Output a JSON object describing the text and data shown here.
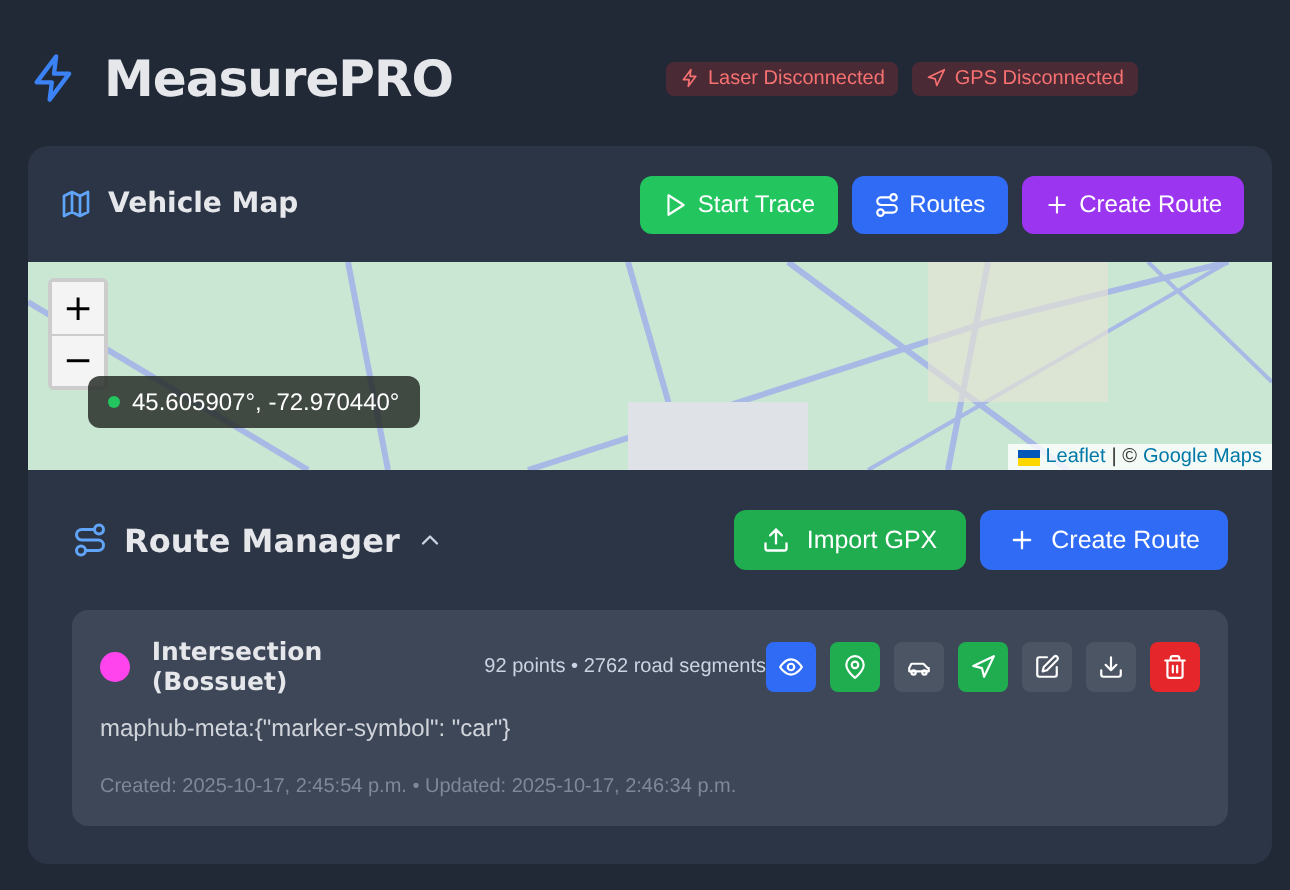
{
  "app": {
    "title": "MeasurePRO"
  },
  "status_badges": [
    {
      "label": "Laser Disconnected",
      "connected": false
    },
    {
      "label": "GPS Disconnected",
      "connected": false
    }
  ],
  "vehicle_map": {
    "title": "Vehicle Map",
    "buttons": [
      {
        "label": "Start Trace",
        "color": "#22c55e"
      },
      {
        "label": "Routes",
        "color": "#2f6bf5"
      },
      {
        "label": "Create Route",
        "color": "#9b35f0"
      }
    ],
    "zoom_in": "+",
    "zoom_out": "−",
    "coordinates": "45.605907°, -72.970440°",
    "attribution": {
      "leaflet": "Leaflet",
      "separator": "| ©",
      "provider": "Google Maps"
    }
  },
  "route_manager": {
    "title": "Route Manager",
    "expanded": true,
    "buttons": [
      {
        "label": "Import GPX",
        "color": "#1fad50"
      },
      {
        "label": "Create Route",
        "color": "#2f6bf5"
      }
    ],
    "routes": [
      {
        "name": "Intersection (Bossuet)",
        "color": "#ff44ee",
        "stats": "92 points • 2762 road segments",
        "description": "maphub-meta:{\"marker-symbol\": \"car\"}",
        "timestamps": "Created: 2025-10-17, 2:45:54 p.m. • Updated: 2025-10-17, 2:46:34 p.m.",
        "actions": [
          {
            "color": "#2f6bf5"
          },
          {
            "color": "#1fad50"
          },
          {
            "color": "#4b5563"
          },
          {
            "color": "#1fad50"
          },
          {
            "color": "#4b5563"
          },
          {
            "color": "#4b5563"
          },
          {
            "color": "#e5262b"
          }
        ]
      }
    ]
  }
}
